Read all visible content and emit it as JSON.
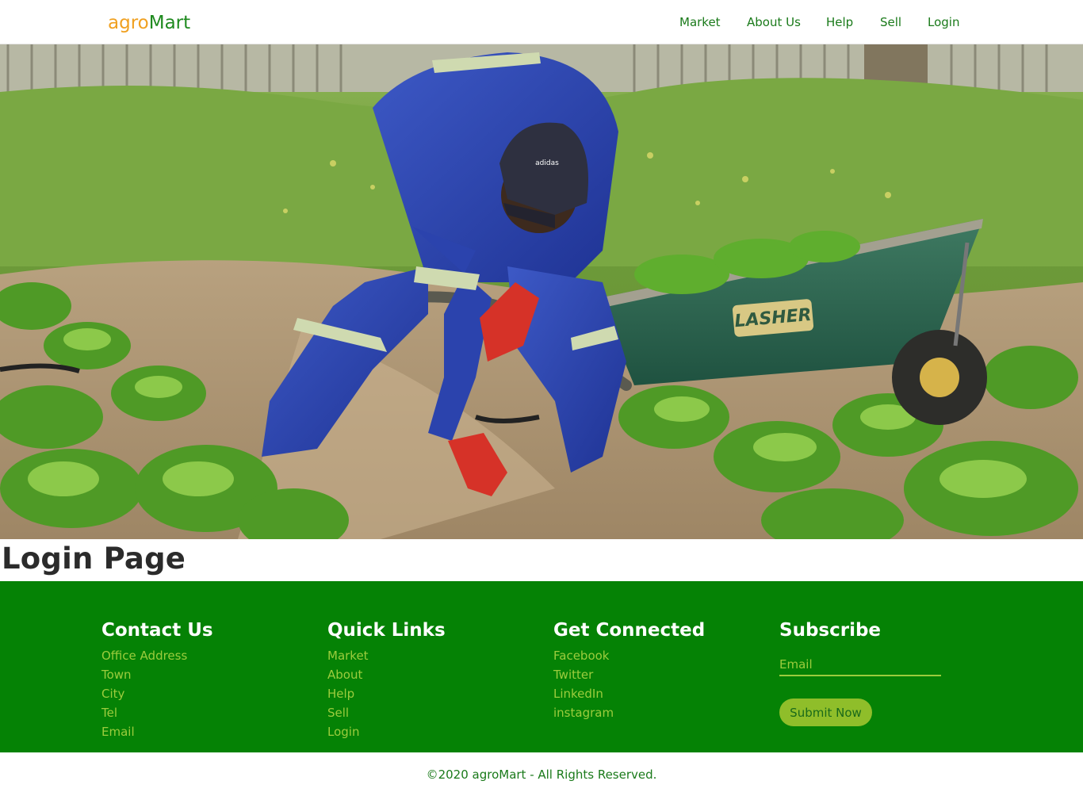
{
  "brand": {
    "part1": "agro",
    "part2": "Mart"
  },
  "nav": {
    "items": [
      "Market",
      "About Us",
      "Help",
      "Sell",
      "Login"
    ]
  },
  "page": {
    "title": "Login Page"
  },
  "footer": {
    "contact": {
      "heading": "Contact Us",
      "items": [
        "Office Address",
        "Town",
        "City",
        "Tel",
        "Email"
      ]
    },
    "quick_links": {
      "heading": "Quick Links",
      "items": [
        "Market",
        "About",
        "Help",
        "Sell",
        "Login"
      ]
    },
    "connected": {
      "heading": "Get Connected",
      "items": [
        "Facebook",
        "Twitter",
        "LinkedIn",
        "instagram"
      ]
    },
    "subscribe": {
      "heading": "Subscribe",
      "email_placeholder": "Email",
      "button_label": "Submit Now"
    }
  },
  "copyright": "©2020 agroMart - All Rights Reserved.",
  "hero": {
    "wheelbarrow_text": "LASHER",
    "cap_text": "adidas"
  },
  "colors": {
    "brand_orange": "#f0a020",
    "brand_green": "#1f8a1f",
    "footer_bg": "#058205",
    "footer_link": "#9ccc3d",
    "button_bg": "#8fbe2a"
  }
}
